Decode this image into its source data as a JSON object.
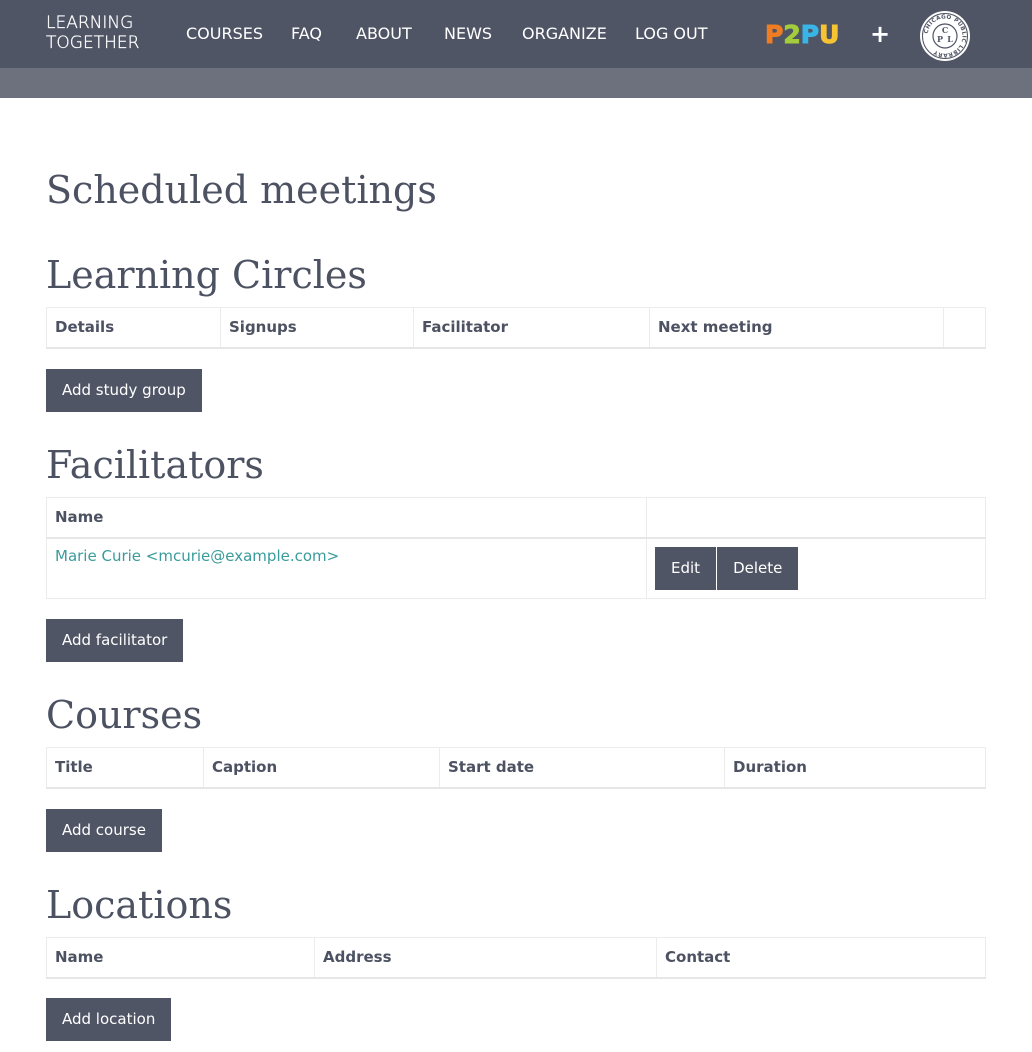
{
  "nav": {
    "brand_line1": "LEARNING",
    "brand_line2": "TOGETHER",
    "links": [
      "COURSES",
      "FAQ",
      "ABOUT",
      "NEWS",
      "ORGANIZE",
      "LOG OUT"
    ],
    "plus": "+",
    "p2pu_letters": [
      "P",
      "2",
      "P",
      "U"
    ],
    "p2pu_colors": [
      "#f07d22",
      "#a3cd3b",
      "#38b5e6",
      "#f6c334"
    ],
    "library_logo_text": "CHICAGO PUBLIC LIBRARY",
    "library_logo_initials": "CPL"
  },
  "page_title": "Scheduled meetings",
  "learning_circles": {
    "heading": "Learning Circles",
    "columns": [
      "Details",
      "Signups",
      "Facilitator",
      "Next meeting",
      ""
    ],
    "add_button": "Add study group"
  },
  "facilitators": {
    "heading": "Facilitators",
    "columns": [
      "Name",
      ""
    ],
    "rows": [
      {
        "name": "Marie Curie <mcurie@example.com>",
        "edit": "Edit",
        "delete": "Delete"
      }
    ],
    "add_button": "Add facilitator"
  },
  "courses": {
    "heading": "Courses",
    "columns": [
      "Title",
      "Caption",
      "Start date",
      "Duration"
    ],
    "add_button": "Add course"
  },
  "locations": {
    "heading": "Locations",
    "columns": [
      "Name",
      "Address",
      "Contact"
    ],
    "add_button": "Add location"
  }
}
